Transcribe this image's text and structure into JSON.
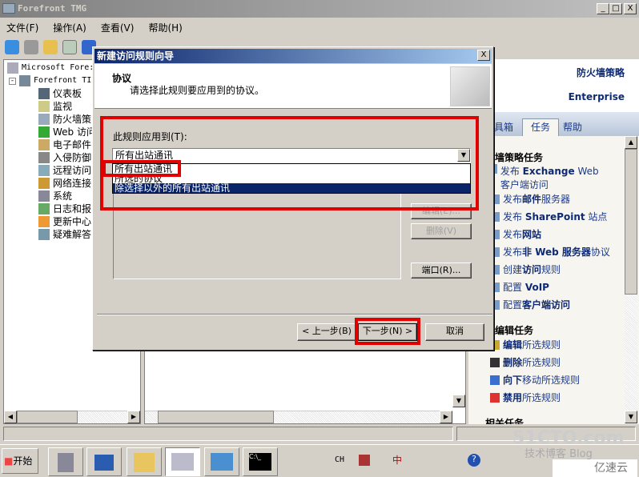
{
  "window": {
    "title": "Forefront TMG",
    "min": "_",
    "max": "□",
    "close": "X"
  },
  "menu": [
    "文件(F)",
    "操作(A)",
    "查看(V)",
    "帮助(H)"
  ],
  "tree": {
    "root": "Microsoft Fore:",
    "server": "Forefront TI",
    "items": [
      "仪表板",
      "监视",
      "防火墙策",
      "Web 访问",
      "电子邮件",
      "入侵防御",
      "远程访问",
      "网络连接",
      "系统",
      "日志和报",
      "更新中心",
      "疑难解答"
    ]
  },
  "right": {
    "title": "防火墙策略",
    "edition": "Enterprise",
    "tabs": [
      "具箱",
      "任务",
      "帮助"
    ],
    "section1": "火墙策略任务",
    "tasks1": [
      [
        "发布 ",
        "Exchange",
        " Web 客户端访问"
      ],
      [
        "发布",
        "邮件",
        "服务器"
      ],
      [
        "发布 ",
        "SharePoint",
        " 站点"
      ],
      [
        "发布",
        "网站",
        ""
      ],
      [
        "发布",
        "非 Web 服务器",
        "协议"
      ],
      [
        "创建",
        "访问",
        "规则"
      ],
      [
        "配置 ",
        "VoIP",
        ""
      ],
      [
        "配置",
        "客户端访问",
        ""
      ]
    ],
    "section2": "略编辑任务",
    "tasks2": [
      [
        "",
        "编辑",
        "所选规则"
      ],
      [
        "",
        "删除",
        "所选规则"
      ],
      [
        "",
        "向下",
        "移动所选规则"
      ],
      [
        "",
        "禁用",
        "所选规则"
      ]
    ],
    "section3": "相关任务"
  },
  "dialog": {
    "title": "新建访问规则向导",
    "close": "X",
    "header_title": "协议",
    "header_desc": "请选择此规则要应用到的协议。",
    "apply_label": "此规则应用到(T):",
    "combo_value": "所有出站通讯",
    "options": [
      "所有出站通讯",
      "所选的协议",
      "除选择以外的所有出站通讯"
    ],
    "selected_option": 2,
    "buttons": {
      "edit": "编辑(E)...",
      "delete": "删除(V)",
      "ports": "端口(R)..."
    },
    "back": "< 上一步(B)",
    "next": "下一步(N) >",
    "cancel": "取消"
  },
  "taskbar": {
    "start": "开始",
    "lang": "CH",
    "ime": "中",
    "watermark1": "51CTO.com",
    "watermark2": "技术博客 Blog",
    "watermark3": "亿速云"
  },
  "colors": {
    "accent": "#0a246a",
    "highlight": "#e00000"
  }
}
